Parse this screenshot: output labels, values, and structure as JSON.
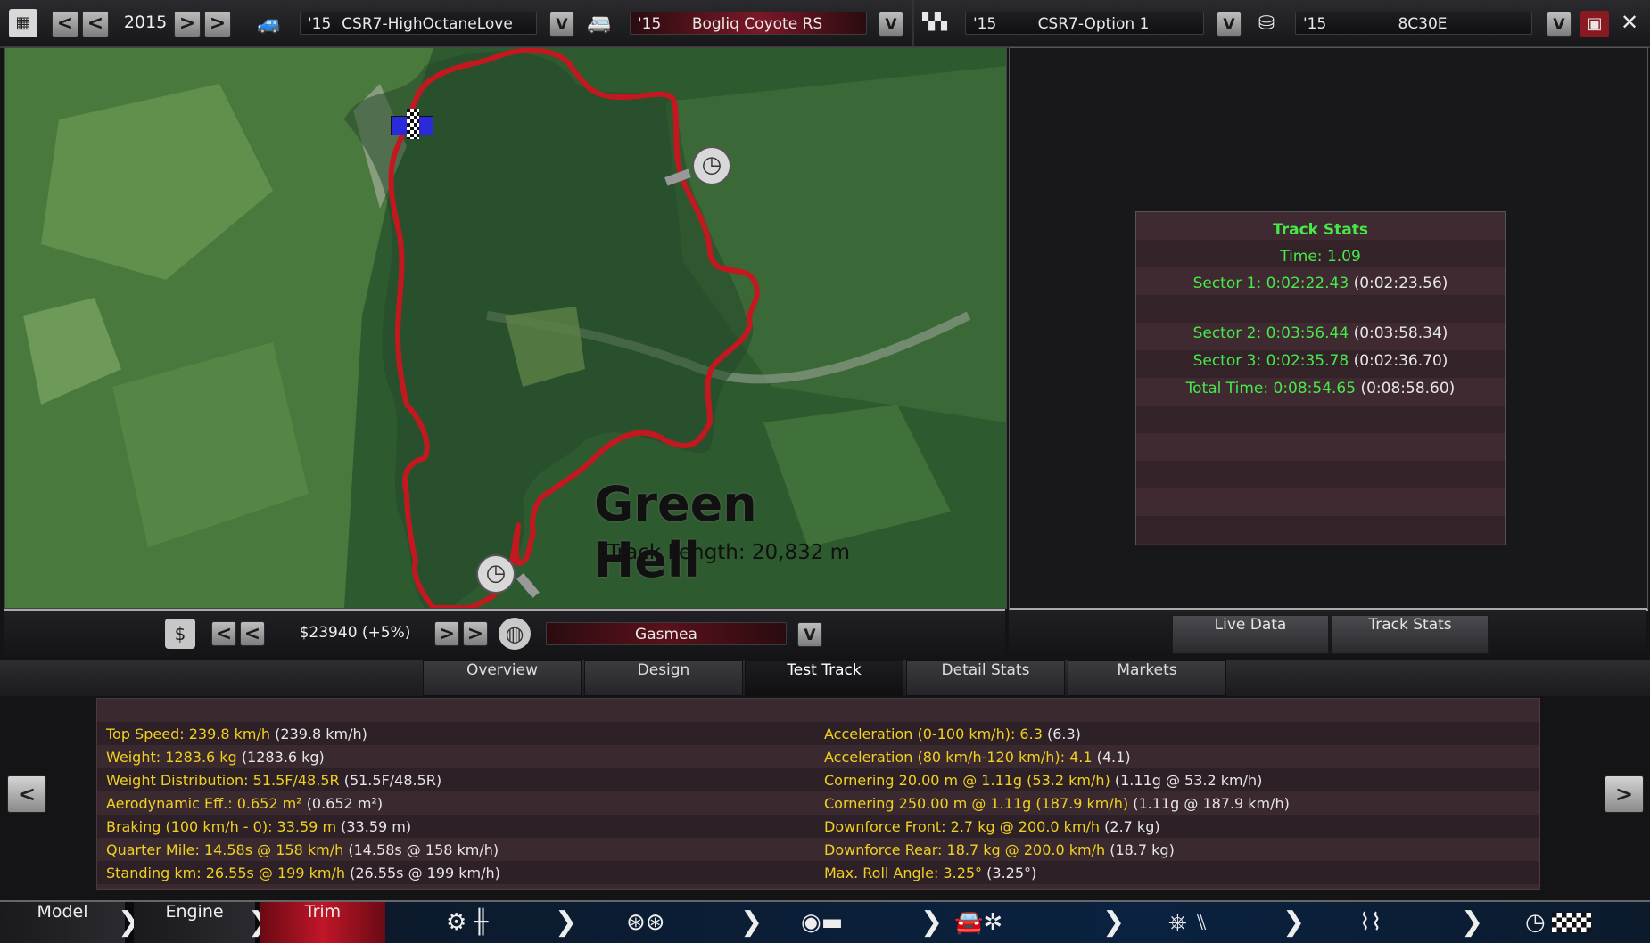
{
  "topbar": {
    "year": "2015",
    "car_body": {
      "year": "'15",
      "name": "CSR7-HighOctaneLove"
    },
    "car_model": {
      "year": "'15",
      "name": "Bogliq Coyote RS"
    },
    "trim": {
      "year": "'15",
      "name": "CSR7-Option 1"
    },
    "engine": {
      "year": "'15",
      "name": "8C30E"
    },
    "prev_label": "<",
    "next_label": ">",
    "dropdown_label": "V"
  },
  "map": {
    "track_name": "Green Hell",
    "track_length": "Track Length: 20,832 m"
  },
  "mapbar": {
    "price": "$23940 (+5%)",
    "market": "Gasmea",
    "prev_label": "<",
    "next_label": ">",
    "dropdown_label": "V"
  },
  "track_stats": {
    "title": "Track Stats",
    "time": "Time: 1.09",
    "sector1": {
      "label": "Sector 1: 0:02:22.43",
      "ref": "(0:02:23.56)"
    },
    "sector2": {
      "label": "Sector 2: 0:03:56.44",
      "ref": "(0:03:58.34)"
    },
    "sector3": {
      "label": "Sector 3: 0:02:35.78",
      "ref": "(0:02:36.70)"
    },
    "total": {
      "label": "Total Time: 0:08:54.65",
      "ref": "(0:08:58.60)"
    }
  },
  "right_tabs": {
    "live_data": "Live Data",
    "track_stats": "Track Stats"
  },
  "mid_tabs": [
    "Overview",
    "Design",
    "Test Track",
    "Detail Stats",
    "Markets"
  ],
  "details": {
    "left": [
      {
        "label": "Top Speed: 239.8 km/h",
        "ref": "(239.8 km/h)"
      },
      {
        "label": "Weight: 1283.6 kg",
        "ref": "(1283.6 kg)"
      },
      {
        "label": "Weight Distribution: 51.5F/48.5R",
        "ref": "(51.5F/48.5R)"
      },
      {
        "label": "Aerodynamic Eff.: 0.652 m²",
        "ref": "(0.652 m²)"
      },
      {
        "label": "Braking (100 km/h - 0): 33.59 m",
        "ref": "(33.59 m)"
      },
      {
        "label": "Quarter Mile: 14.58s @ 158 km/h",
        "ref": "(14.58s @ 158 km/h)"
      },
      {
        "label": "Standing km: 26.55s @ 199 km/h",
        "ref": "(26.55s @ 199 km/h)"
      }
    ],
    "right": [
      {
        "label": "Acceleration (0-100 km/h): 6.3",
        "ref": "(6.3)"
      },
      {
        "label": "Acceleration (80 km/h-120 km/h): 4.1",
        "ref": "(4.1)"
      },
      {
        "label": "Cornering 20.00 m @ 1.11g (53.2 km/h)",
        "ref": "(1.11g @ 53.2 km/h)"
      },
      {
        "label": "Cornering 250.00 m @ 1.11g (187.9 km/h)",
        "ref": "(1.11g @ 187.9 km/h)"
      },
      {
        "label": "Downforce Front: 2.7 kg @ 200.0 km/h",
        "ref": "(2.7 kg)"
      },
      {
        "label": "Downforce Rear: 18.7 kg @ 200.0 km/h",
        "ref": "(18.7 kg)"
      },
      {
        "label": "Max. Roll Angle: 3.25°",
        "ref": "(3.25°)"
      }
    ],
    "prev_label": "<",
    "next_label": ">"
  },
  "bottom_nav": {
    "model": "Model",
    "engine": "Engine",
    "trim": "Trim"
  }
}
